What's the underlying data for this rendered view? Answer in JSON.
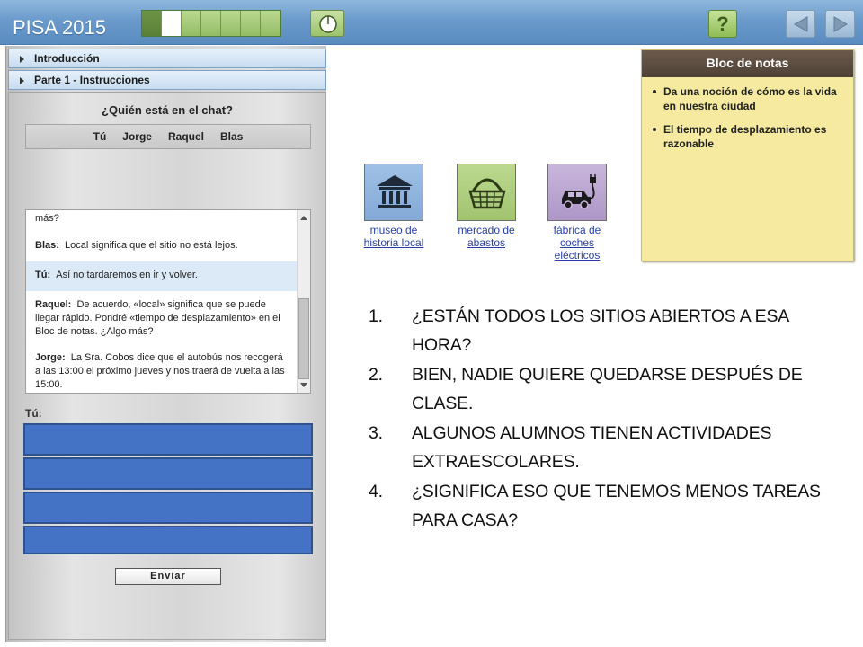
{
  "app": {
    "title": "PISA 2015"
  },
  "progress": {
    "total_steps": 7,
    "completed_steps": 1,
    "current_step": 2
  },
  "accordion": [
    {
      "label": "Introducción"
    },
    {
      "label": "Parte 1 - Instrucciones"
    }
  ],
  "chat": {
    "question": "¿Quién está en el chat?",
    "participants": [
      "Tú",
      "Jorge",
      "Raquel",
      "Blas"
    ],
    "messages": [
      {
        "speaker": "",
        "text": "más?"
      },
      {
        "speaker": "Blas:",
        "text": "Local significa que el sitio no está lejos."
      },
      {
        "speaker": "Tú:",
        "text": "Así no tardaremos en ir y volver."
      },
      {
        "speaker": "Raquel:",
        "text": "De acuerdo, «local» significa que se puede llegar rápido. Pondré «tiempo de desplazamiento» en el Bloc de notas. ¿Algo más?"
      },
      {
        "speaker": "Jorge:",
        "text": "La Sra. Cobos dice que el autobús nos recogerá a las 13:00 el próximo jueves y nos traerá de vuelta a las 15:00."
      }
    ],
    "input_label": "Tú:",
    "send_label": "Enviar"
  },
  "places": [
    {
      "label": "museo de historia local",
      "icon": "museum-icon"
    },
    {
      "label": "mercado de abastos",
      "icon": "basket-icon"
    },
    {
      "label": "fábrica de coches eléctricos",
      "icon": "electric-car-icon"
    }
  ],
  "notepad": {
    "title": "Bloc de notas",
    "items": [
      "Da una noción de cómo es la vida en nuestra ciudad",
      "El tiempo de desplazamiento es razonable"
    ]
  },
  "questions": [
    {
      "num": "1.",
      "text": "¿ESTÁN TODOS LOS SITIOS ABIERTOS A ESA HORA?"
    },
    {
      "num": "2.",
      "text": "BIEN, NADIE QUIERE QUEDARSE DESPUÉS DE CLASE."
    },
    {
      "num": "3.",
      "text": "ALGUNOS ALUMNOS TIENEN ACTIVIDADES EXTRAESCOLARES."
    },
    {
      "num": "4.",
      "text": "¿SIGNIFICA ESO QUE TENEMOS MENOS TAREAS PARA CASA?"
    }
  ],
  "colors": {
    "accent": "#4472c4",
    "topbar": "#6b9bcc",
    "progress_done": "#5a7f37",
    "notepad": "#f6eaa0"
  }
}
